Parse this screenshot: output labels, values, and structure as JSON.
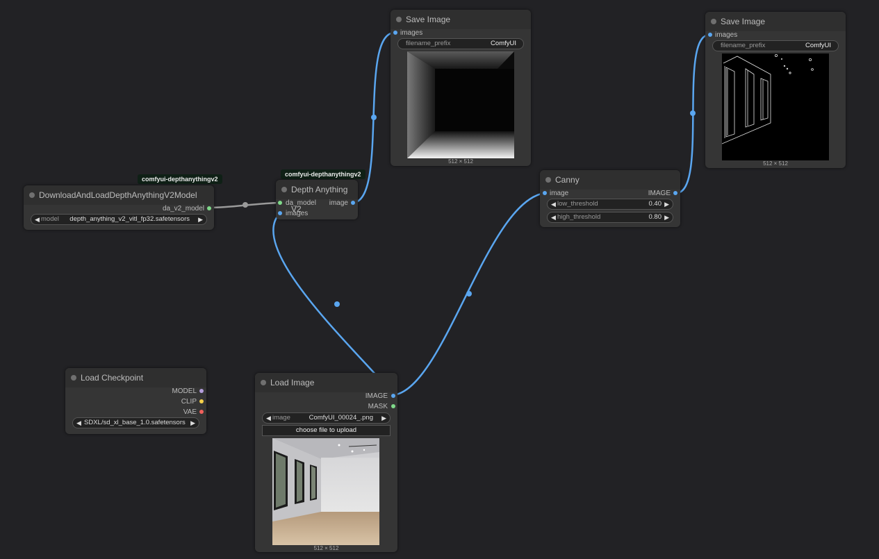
{
  "colors": {
    "background": "#222225",
    "image_link": "#5aa6f0",
    "model_link": "#9a9a9a"
  },
  "download_node": {
    "badge": "comfyui-depthanythingv2",
    "title": "DownloadAndLoadDepthAnythingV2Model",
    "output": "da_v2_model",
    "model_widget": {
      "name": "model",
      "value": "depth_anything_v2_vitl_fp32.safetensors"
    }
  },
  "depth_node": {
    "badge": "comfyui-depthanythingv2",
    "title": "Depth Anything V2",
    "inputs": [
      "da_model",
      "images"
    ],
    "output": "image"
  },
  "save_image_1": {
    "title": "Save Image",
    "input": "images",
    "filename_prefix_label": "filename_prefix",
    "filename_prefix_value": "ComfyUI",
    "dims": "512 × 512"
  },
  "save_image_2": {
    "title": "Save Image",
    "input": "images",
    "filename_prefix_label": "filename_prefix",
    "filename_prefix_value": "ComfyUI",
    "dims": "512 × 512"
  },
  "canny_node": {
    "title": "Canny",
    "input": "image",
    "output": "IMAGE",
    "low_threshold": {
      "name": "low_threshold",
      "value": "0.40"
    },
    "high_threshold": {
      "name": "high_threshold",
      "value": "0.80"
    }
  },
  "load_checkpoint": {
    "title": "Load Checkpoint",
    "outputs": [
      "MODEL",
      "CLIP",
      "VAE"
    ],
    "ckpt_value": "SDXL/sd_xl_base_1.0.safetensors"
  },
  "load_image": {
    "title": "Load Image",
    "outputs": [
      "IMAGE",
      "MASK"
    ],
    "image_widget": {
      "name": "image",
      "value": "ComfyUI_00024_.png"
    },
    "upload_label": "choose file to upload",
    "dims": "512 × 512"
  }
}
